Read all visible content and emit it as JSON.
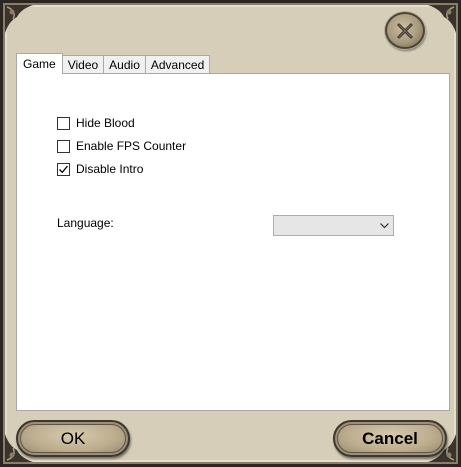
{
  "window": {
    "close_icon": "close-x-icon"
  },
  "tabs": [
    {
      "label": "Game",
      "active": true
    },
    {
      "label": "Video",
      "active": false
    },
    {
      "label": "Audio",
      "active": false
    },
    {
      "label": "Advanced",
      "active": false
    }
  ],
  "game": {
    "options": [
      {
        "label": "Hide Blood",
        "checked": false
      },
      {
        "label": "Enable FPS Counter",
        "checked": false
      },
      {
        "label": "Disable Intro",
        "checked": true
      }
    ],
    "language": {
      "label": "Language:",
      "value": "",
      "icon": "chevron-down-icon"
    }
  },
  "buttons": {
    "ok": "OK",
    "cancel": "Cancel"
  },
  "colors": {
    "frame": "#d6ceb9",
    "panel": "#ffffff",
    "button": "#bcad8e"
  }
}
